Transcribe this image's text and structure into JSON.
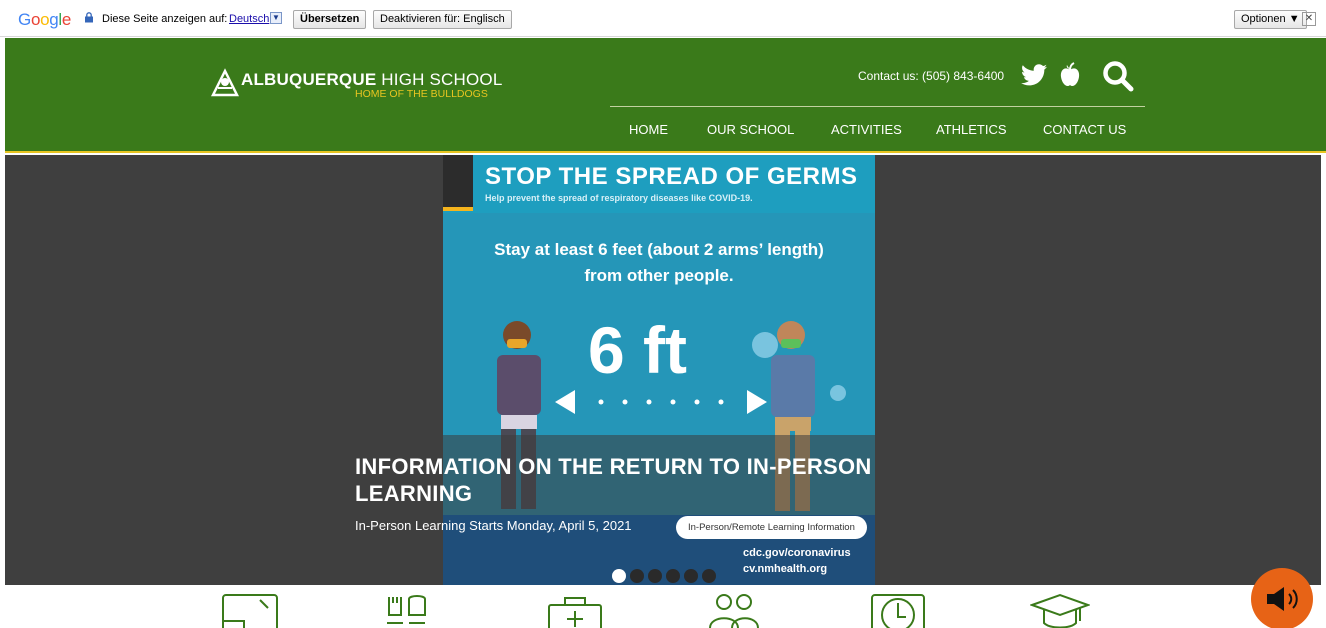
{
  "translate_bar": {
    "brand": "Google",
    "prompt": "Diese Seite anzeigen auf:",
    "language": "Deutsch",
    "translate_label": "Übersetzen",
    "disable_label": "Deaktivieren für: Englisch",
    "options_label": "Optionen ▼",
    "close_symbol": "✕"
  },
  "header": {
    "school_bold": "ALBUQUERQUE",
    "school_rest": " HIGH SCHOOL",
    "tagline": "HOME OF THE BULLDOGS",
    "contact": "Contact us: (505) 843-6400",
    "bg_color": "#3a7a1a",
    "accent_color": "#e8c521"
  },
  "nav": {
    "items": [
      {
        "label": "HOME"
      },
      {
        "label": "OUR SCHOOL"
      },
      {
        "label": "ACTIVITIES"
      },
      {
        "label": "ATHLETICS"
      },
      {
        "label": "CONTACT US"
      }
    ]
  },
  "poster": {
    "title": "STOP THE SPREAD OF GERMS",
    "subtitle": "Help prevent the spread of respiratory diseases like COVID-19.",
    "line1": "Stay at least 6 feet (about 2 arms’ length)",
    "line2": "from other people.",
    "big": "6 ft",
    "footer1": "cdc.gov/coronavirus",
    "footer2": "cv.nmhealth.org"
  },
  "hero": {
    "title": "INFORMATION ON THE RETURN TO IN-PERSON LEARNING",
    "subtitle": "In-Person Learning Starts Monday, April 5, 2021",
    "button_label": "In-Person/Remote Learning Information",
    "slide_count": 6,
    "active_slide": 1
  },
  "quick_icons": [
    "tablet-icon",
    "hands-icon",
    "first-aid-icon",
    "people-icon",
    "clock-icon",
    "graduation-cap-icon"
  ],
  "audio": {
    "icon": "speaker-icon",
    "color": "#e76316"
  }
}
